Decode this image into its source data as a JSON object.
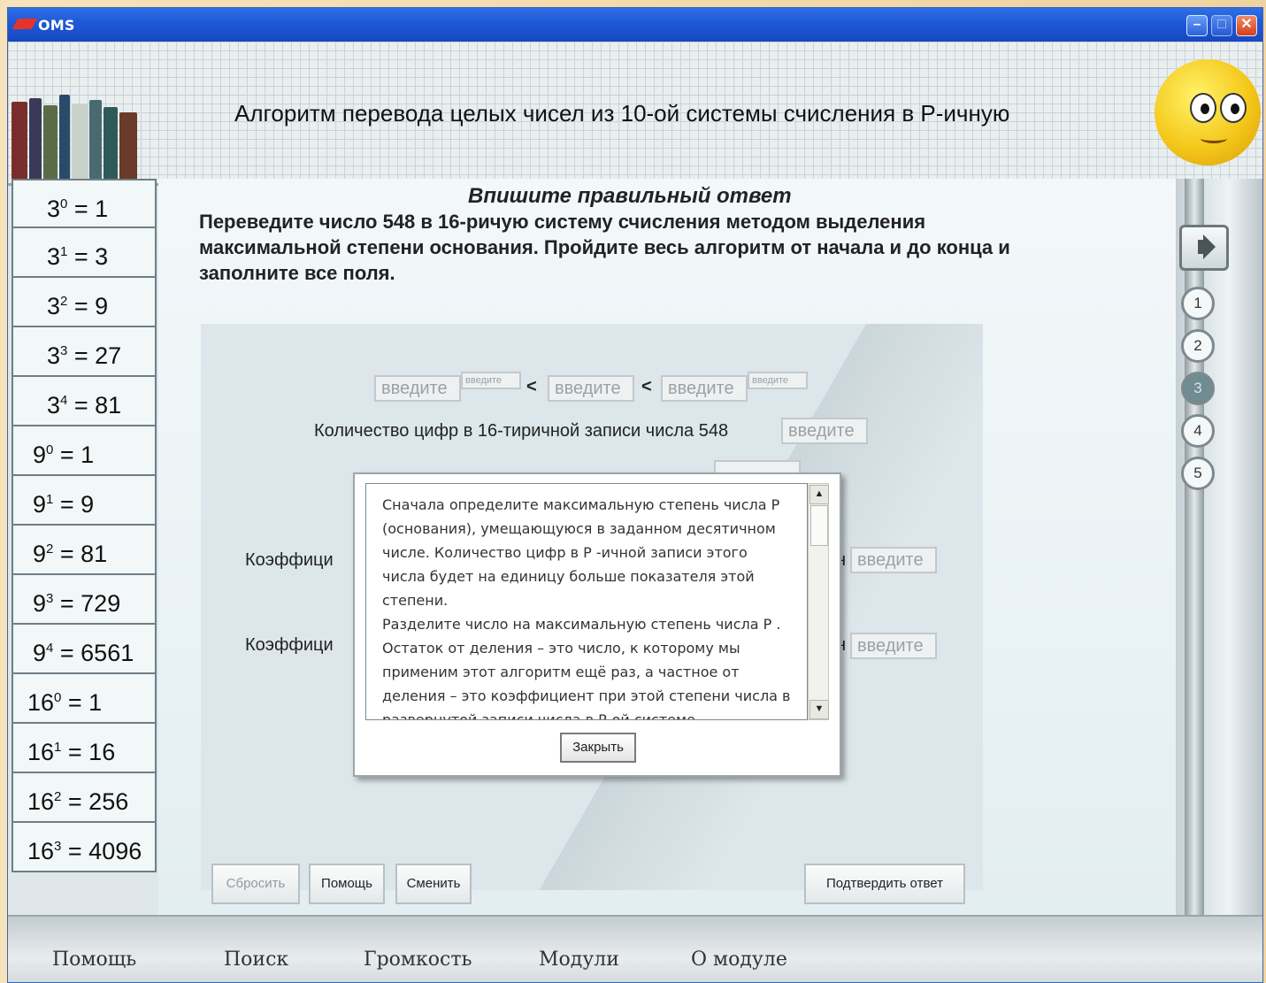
{
  "window": {
    "title": "OMS"
  },
  "header": {
    "title": "Алгоритм перевода целых чисел из 10-ой системы счисления в Р-ичную"
  },
  "powers": [
    {
      "base": "3",
      "exp": "0",
      "value": "1"
    },
    {
      "base": "3",
      "exp": "1",
      "value": "3"
    },
    {
      "base": "3",
      "exp": "2",
      "value": "9"
    },
    {
      "base": "3",
      "exp": "3",
      "value": "27"
    },
    {
      "base": "3",
      "exp": "4",
      "value": "81"
    },
    {
      "base": "9",
      "exp": "0",
      "value": "1"
    },
    {
      "base": "9",
      "exp": "1",
      "value": "9"
    },
    {
      "base": "9",
      "exp": "2",
      "value": "81"
    },
    {
      "base": "9",
      "exp": "3",
      "value": "729"
    },
    {
      "base": "9",
      "exp": "4",
      "value": "6561"
    },
    {
      "base": "16",
      "exp": "0",
      "value": "1"
    },
    {
      "base": "16",
      "exp": "1",
      "value": "16"
    },
    {
      "base": "16",
      "exp": "2",
      "value": "256"
    },
    {
      "base": "16",
      "exp": "3",
      "value": "4096"
    }
  ],
  "task": {
    "heading": "Впишите правильный ответ",
    "text": "Переведите число 548 в 16-ричую систему счисления методом выделения максимальной степени основания. Пройдите весь алгоритм от начала и до конца и заполните все поля."
  },
  "work": {
    "placeholder": "введите",
    "lt": "<",
    "digits_label": "Количество цифр в 16-тиричной записи числа 548",
    "coef_label": "Коэффици",
    "coef_tail": "н"
  },
  "buttons": {
    "reset": "Сбросить",
    "help": "Помощь",
    "change": "Сменить",
    "confirm": "Подтвердить ответ"
  },
  "steps": [
    "1",
    "2",
    "3",
    "4",
    "5"
  ],
  "active_step": "3",
  "dialog": {
    "text": "Сначала определите максимальную степень числа  P  (основания), умещающуюся в заданном десятичном числе. Количество цифр в  P -ичной записи этого числа будет на единицу больше показателя этой степени.\nРазделите число на максимальную степень числа  P . Остаток от деления – это число, к которому мы применим этот алгоритм ещё раз, а частное от деления – это коэффициент при этой степени числа в развернутой записи числа в Р-ой системе",
    "close": "Закрыть"
  },
  "footer": [
    "Помощь",
    "Поиск",
    "Громкость",
    "Модули",
    "О модуле"
  ]
}
